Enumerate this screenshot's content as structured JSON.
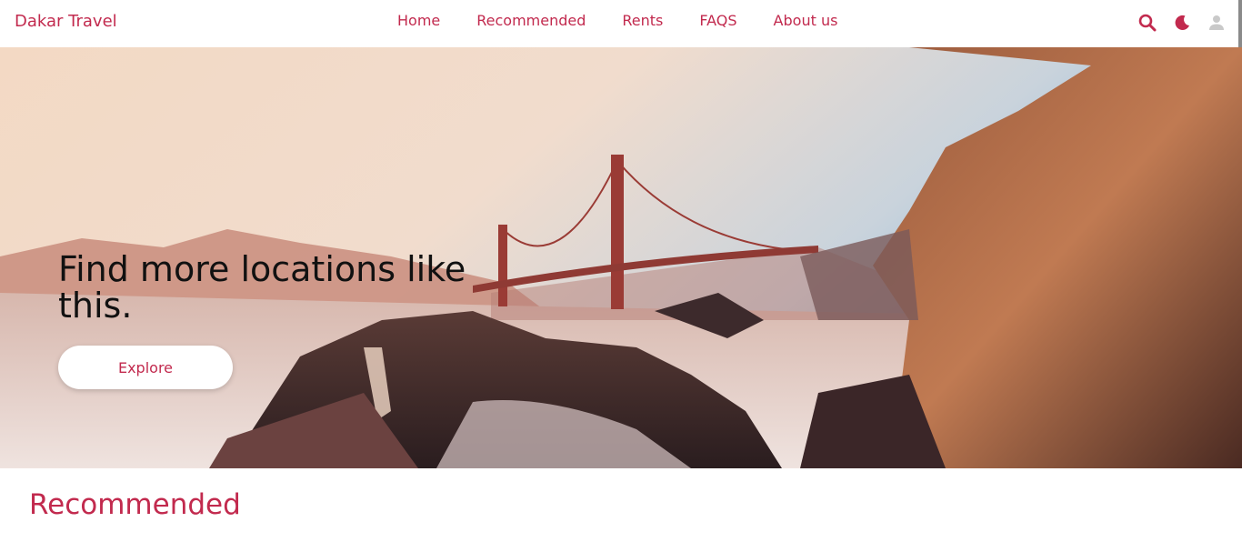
{
  "nav": {
    "brand": "Dakar Travel",
    "links": [
      "Home",
      "Recommended",
      "Rents",
      "FAQS",
      "About us"
    ],
    "icons": [
      "search-icon",
      "moon-icon",
      "user-icon"
    ]
  },
  "hero": {
    "title": "Find more locations like this.",
    "button_label": "Explore"
  },
  "section": {
    "title": "Recommended"
  },
  "colors": {
    "accent": "#c22a4e",
    "user_icon": "#c9c9c9",
    "hero_text": "#111111"
  }
}
